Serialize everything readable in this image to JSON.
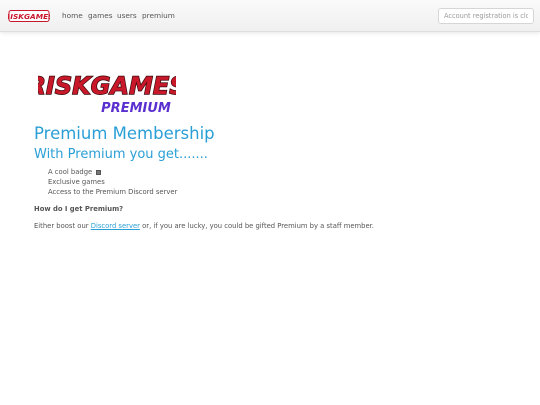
{
  "navbar": {
    "brand_text": "RISKGAMES",
    "links": [
      {
        "label": "home"
      },
      {
        "label": "games"
      },
      {
        "label": "users"
      },
      {
        "label": "premium"
      }
    ],
    "search": {
      "placeholder": "Account registration is closed"
    }
  },
  "colors": {
    "accent": "#2a9fd6",
    "logo_red": "#c8182a",
    "premium_purple": "#5a2fd0"
  },
  "logo": {
    "main_text": "RISKGAMES",
    "sub_text": "PREMIUM"
  },
  "main": {
    "title": "Premium Membership",
    "subtitle": "With Premium you get.......",
    "perks": [
      {
        "text": "A cool badge"
      },
      {
        "text": "Exclusive games"
      },
      {
        "text": "Access to the Premium Discord server"
      }
    ],
    "question": "How do I get Premium?",
    "answer": {
      "before": "Either boost our ",
      "link": "Discord server",
      "after": " or, if you are lucky, you could be gifted Premium by a staff member."
    }
  }
}
